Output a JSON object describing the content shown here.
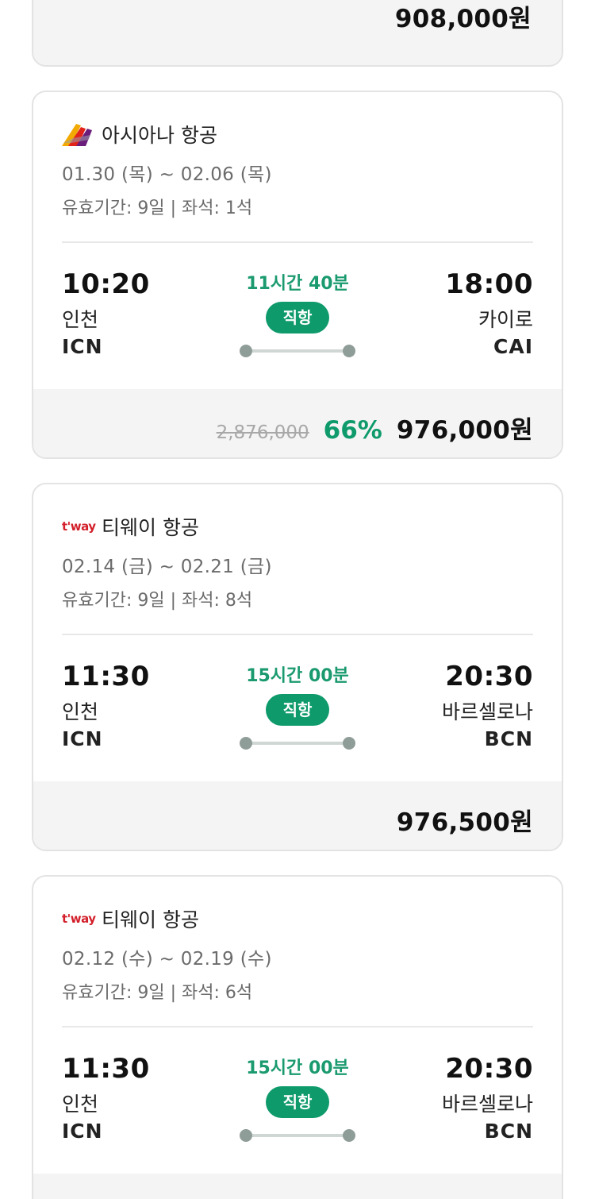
{
  "top_card": {
    "price": "908,000원"
  },
  "flights": [
    {
      "airline": "아시아나 항공",
      "logo": "asiana-logo",
      "dates": "01.30 (목) ~ 02.06 (목)",
      "validity": "유효기간: 9일 | 좌석: 1석",
      "dep_time": "10:20",
      "dep_city": "인천",
      "dep_code": "ICN",
      "duration": "11시간 40분",
      "badge": "직항",
      "arr_time": "18:00",
      "arr_city": "카이로",
      "arr_code": "CAI",
      "original_price": "2,876,000",
      "discount": "66%",
      "price": "976,000원"
    },
    {
      "airline": "티웨이 항공",
      "logo": "tway-logo",
      "logo_text": "t'way",
      "dates": "02.14 (금) ~ 02.21 (금)",
      "validity": "유효기간: 9일 | 좌석: 8석",
      "dep_time": "11:30",
      "dep_city": "인천",
      "dep_code": "ICN",
      "duration": "15시간 00분",
      "badge": "직항",
      "arr_time": "20:30",
      "arr_city": "바르셀로나",
      "arr_code": "BCN",
      "price": "976,500원"
    },
    {
      "airline": "티웨이 항공",
      "logo": "tway-logo",
      "logo_text": "t'way",
      "dates": "02.12 (수) ~ 02.19 (수)",
      "validity": "유효기간: 9일 | 좌석: 6석",
      "dep_time": "11:30",
      "dep_city": "인천",
      "dep_code": "ICN",
      "duration": "15시간 00분",
      "badge": "직항",
      "arr_time": "20:30",
      "arr_city": "바르셀로나",
      "arr_code": "BCN"
    }
  ],
  "colors": {
    "accent_green": "#0e9a6b",
    "tway_red": "#d31f2a",
    "card_border": "#e3e3e3",
    "footer_bg": "#f4f4f4"
  }
}
